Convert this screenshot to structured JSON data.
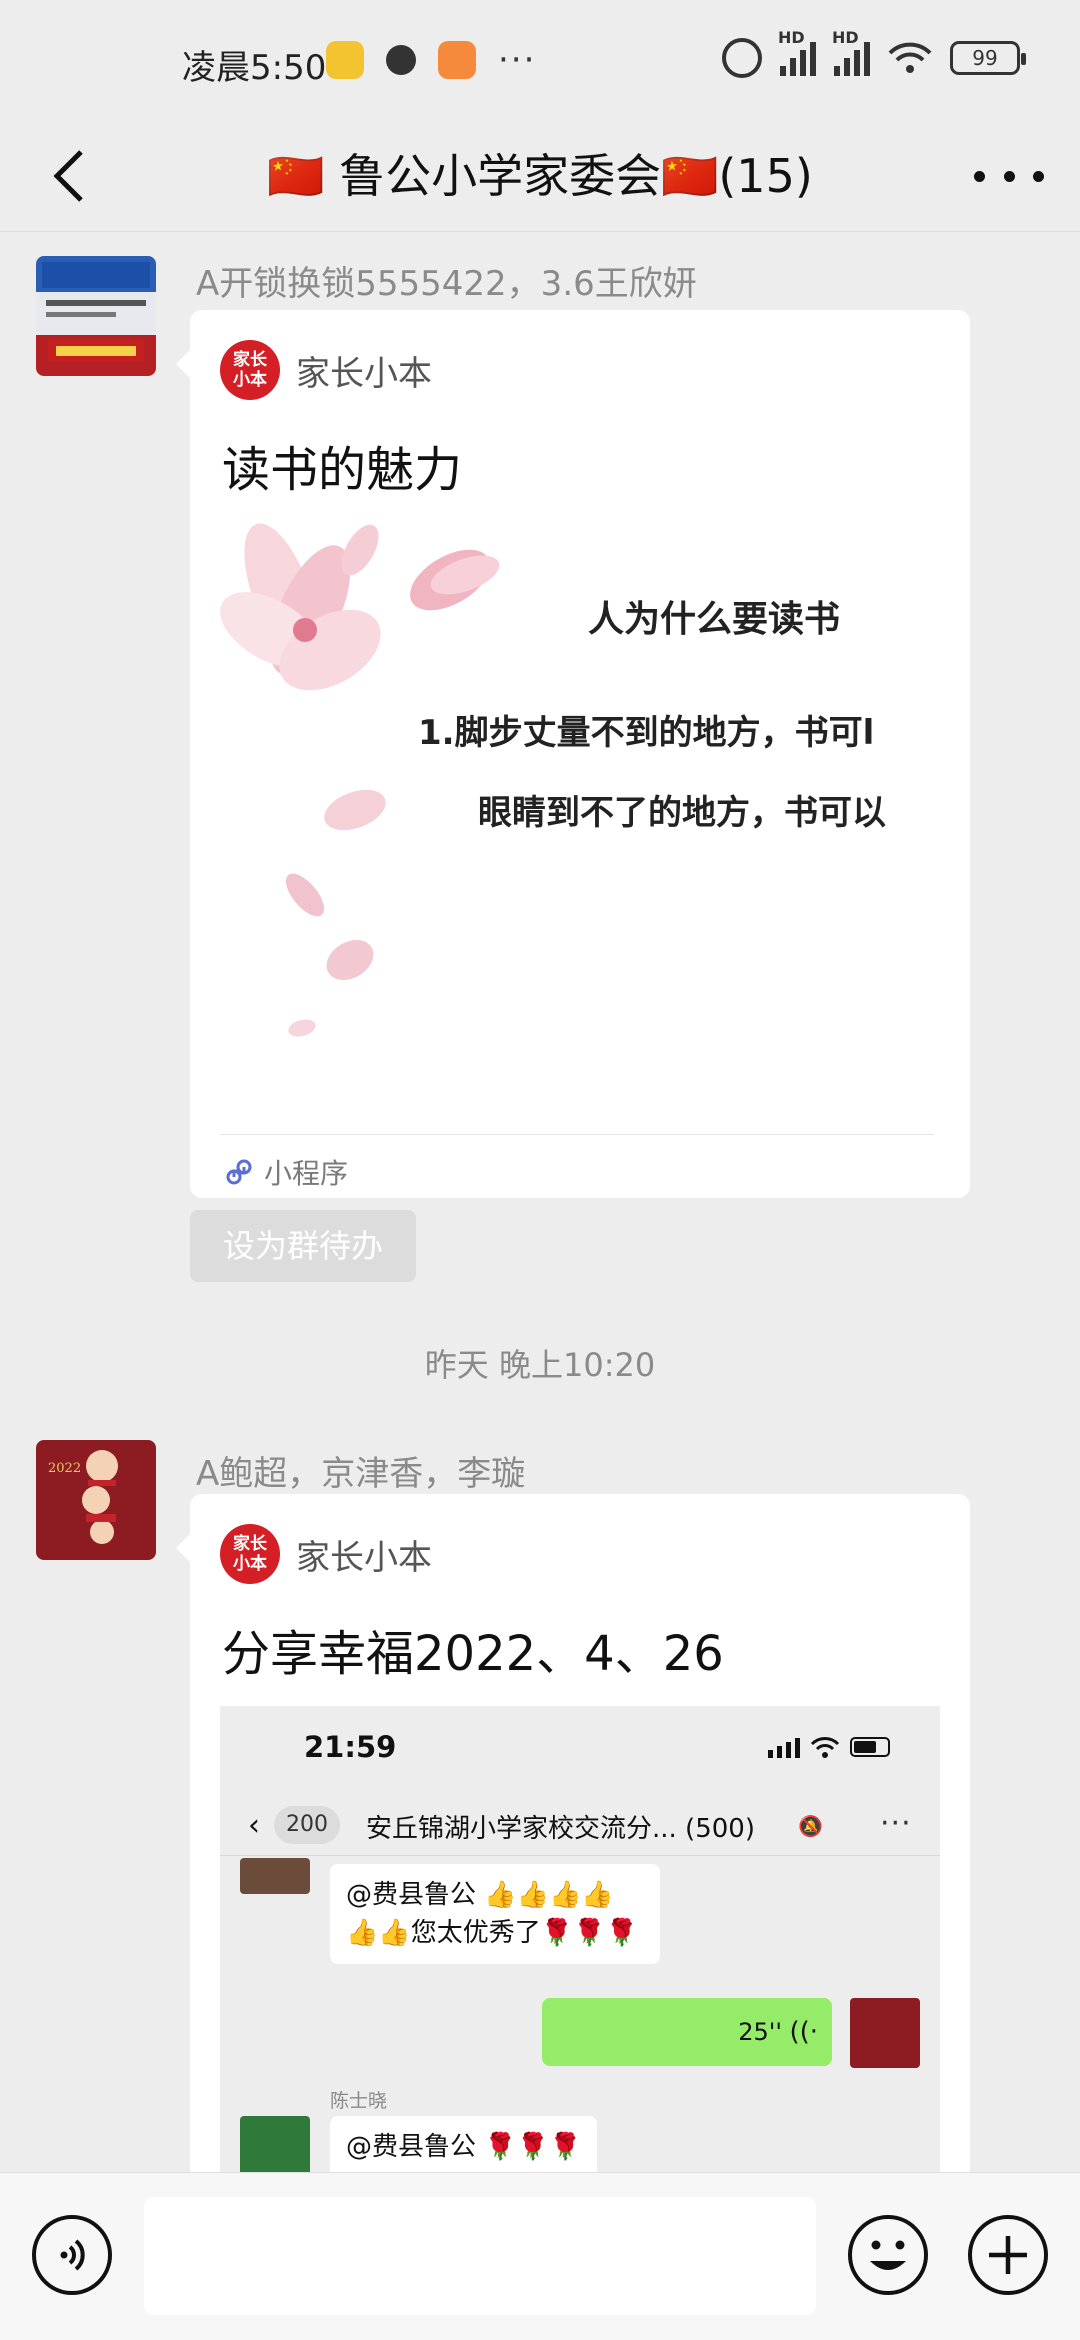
{
  "status_bar": {
    "time": "凌晨5:50",
    "more": "···",
    "hd1": "HD",
    "hd2": "HD",
    "battery": "99"
  },
  "nav": {
    "title": "🇨🇳 鲁公小学家委会🇨🇳(15)"
  },
  "messages": [
    {
      "sender": "A开锁换锁5555422，3.6王欣妍",
      "avatar_icon": "locksmith-sign",
      "card": {
        "app_name": "家长小本",
        "app_logo_text": "家长小本",
        "title": "读书的魅力",
        "image_lines": [
          "人为什么要读书",
          "1.脚步丈量不到的地方，书可l",
          "眼睛到不了的地方，书可以"
        ],
        "footer": "小程序"
      },
      "todo_button": "设为群待办"
    },
    {
      "time_divider": "昨天 晚上10:20",
      "sender": "A鲍超，京津香，李璇",
      "avatar_icon": "new-year-avatar",
      "card": {
        "app_name": "家长小本",
        "app_logo_text": "家长小本",
        "title": "分享幸福2022、4、26",
        "inner_screenshot": {
          "time": "21:59",
          "badge": "200",
          "chat_title": "安丘锦湖小学家校交流分... (500)",
          "bubble1": "@费县鲁公 👍👍👍👍👍👍您太优秀了🌹🌹🌹",
          "voice_duration": "25''",
          "sender_name": "陈士晓",
          "bubble2": "@费县鲁公 🌹🌹🌹"
        }
      }
    }
  ],
  "input_bar": {
    "text_value": ""
  },
  "colors": {
    "background": "#ededed",
    "card": "#ffffff",
    "voice_bubble": "#95ec69",
    "app_logo": "#d41f26"
  }
}
